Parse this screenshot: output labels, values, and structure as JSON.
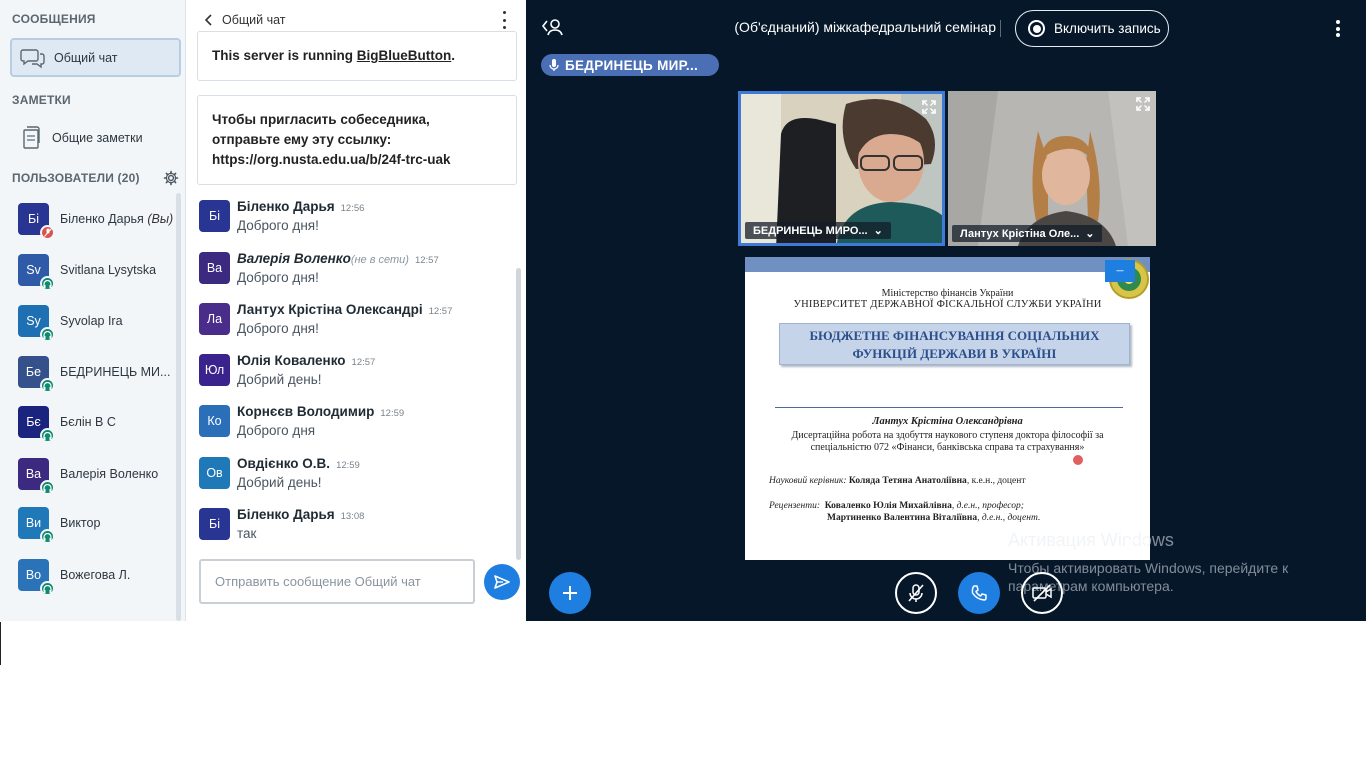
{
  "colors": {
    "accent": "#1e7fe0",
    "main_bg": "#06172a",
    "talker_bg": "#4a6fb5",
    "muted_status": "#d9534f",
    "listen_status": "#0f8a6e"
  },
  "sidebar": {
    "messages_title": "СООБЩЕНИЯ",
    "public_chat_label": "Общий чат",
    "notes_title": "ЗАМЕТКИ",
    "shared_notes_label": "Общие заметки",
    "users_title": "ПОЛЬЗОВАТЕЛИ (20)",
    "users": [
      {
        "initials": "Бі",
        "name": "Біленко Дарья",
        "suffix": "(Вы)",
        "color": "#283593",
        "status": "muted"
      },
      {
        "initials": "Sv",
        "name": "Svitlana Lysytska",
        "suffix": "",
        "color": "#2f5aa8",
        "status": "listen"
      },
      {
        "initials": "Sy",
        "name": "Syvolap Ira",
        "suffix": "",
        "color": "#1f6fb3",
        "status": "listen"
      },
      {
        "initials": "Бе",
        "name": "БЕДРИНЕЦЬ МИ...",
        "suffix": "",
        "color": "#35508a",
        "status": "listen"
      },
      {
        "initials": "Бє",
        "name": "Бєлін В С",
        "suffix": "",
        "color": "#1a237e",
        "status": "listen"
      },
      {
        "initials": "Ва",
        "name": "Валерія Воленко",
        "suffix": "",
        "color": "#3b2a80",
        "status": "listen"
      },
      {
        "initials": "Ви",
        "name": "Виктор",
        "suffix": "",
        "color": "#1f78b8",
        "status": "listen"
      },
      {
        "initials": "Во",
        "name": "Вожегова Л.",
        "suffix": "",
        "color": "#2a73b8",
        "status": "listen"
      }
    ]
  },
  "chat": {
    "back_label": "Общий чат",
    "server_notice_prefix": "This server is running ",
    "server_notice_link": "BigBlueButton",
    "server_notice_suffix": ".",
    "invite_line1": "Чтобы пригласить собеседника,",
    "invite_line2": "отправьте ему эту ссылку:",
    "invite_link": "https://org.nusta.edu.ua/b/24f-trc-uak",
    "messages": [
      {
        "initials": "Бі",
        "color": "#283593",
        "name": "Біленко Дарья",
        "offline": "",
        "time": "12:56",
        "text": "Доброго дня!"
      },
      {
        "initials": "Ва",
        "color": "#3b2a80",
        "name": "Валерія Воленко",
        "offline": "(не в сети)",
        "time": "12:57",
        "text": "Доброго дня!"
      },
      {
        "initials": "Ла",
        "color": "#4a2d8a",
        "name": "Лантух Крістіна Олександрі",
        "offline": "",
        "time": "12:57",
        "text": "Доброго дня!"
      },
      {
        "initials": "Юл",
        "color": "#3a238c",
        "name": "Юлія Коваленко",
        "offline": "",
        "time": "12:57",
        "text": "Добрий день!"
      },
      {
        "initials": "Ко",
        "color": "#2a6fb8",
        "name": "Корнєєв Володимир",
        "offline": "",
        "time": "12:59",
        "text": "Доброго дня"
      },
      {
        "initials": "Ов",
        "color": "#1f78b8",
        "name": "Овдієнко О.В.",
        "offline": "",
        "time": "12:59",
        "text": "Добрий день!"
      },
      {
        "initials": "Бі",
        "color": "#283593",
        "name": "Біленко Дарья",
        "offline": "",
        "time": "13:08",
        "text": "так"
      }
    ],
    "input_placeholder": "Отправить сообщение Общий чат"
  },
  "main": {
    "meeting_title": "(Об'єднаний) міжкафедральний семінар",
    "record_label": "Включить запись",
    "talker": "БЕДРИНЕЦЬ МИР...",
    "videos": [
      {
        "name": "БЕДРИНЕЦЬ МИРО..."
      },
      {
        "name": "Лантух Крістіна Оле..."
      }
    ],
    "slide": {
      "ministry": "Міністерство фінансів України",
      "university": "УНІВЕРСИТЕТ ДЕРЖАВНОЇ ФІСКАЛЬНОЇ СЛУЖБИ УКРАЇНИ",
      "title_line1": "БЮДЖЕТНЕ ФІНАНСУВАННЯ СОЦІАЛЬНИХ",
      "title_line2": "ФУНКЦІЙ ДЕРЖАВИ В УКРАЇНІ",
      "author": "Лантух Крістіна Олександрівна",
      "diss_line1": "Дисертаційна робота на здобуття наукового ступеня доктора філософії за",
      "diss_line2": "спеціальністю 072 «Фінанси, банківська справа та страхування»",
      "advisor_label": "Науковий керівник:",
      "advisor_name": "Коляда Тетяна Анатоліївна",
      "advisor_degree": ", к.е.н., доцент",
      "reviewers_label": "Рецензенти:",
      "reviewer1_name": "Коваленко Юлія Михайлівна",
      "reviewer1_degree": ", д.е.н., професор;",
      "reviewer2_name": "Мартиненко Валентина Віталіївна",
      "reviewer2_degree": ", д.е.н., доцент."
    },
    "activation_title": "Активация Windows",
    "activation_line1": "Чтобы активировать Windows, перейдите к",
    "activation_line2": "параметрам компьютера."
  }
}
